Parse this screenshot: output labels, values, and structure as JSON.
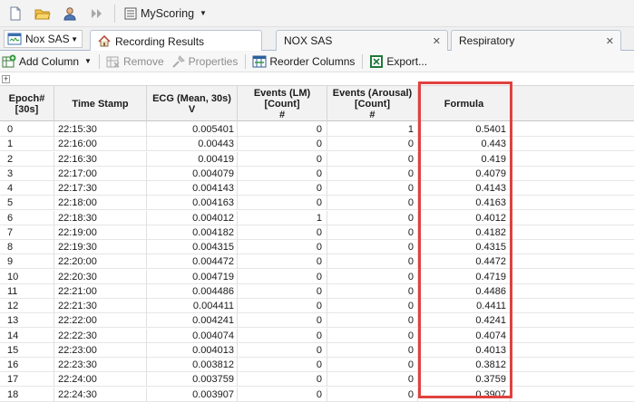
{
  "toolbar": {
    "scoring_label": "MyScoring",
    "icons": [
      "new-file-icon",
      "open-folder-icon",
      "user-icon",
      "forward-icon",
      "scoring-list-icon"
    ]
  },
  "tabbar": {
    "combo_value": "Nox SAS",
    "tabs": [
      {
        "label": "Recording Results",
        "active": true
      },
      {
        "label": "NOX SAS",
        "active": false
      },
      {
        "label": "Respiratory",
        "active": false
      }
    ]
  },
  "actions": {
    "add_column": "Add Column",
    "remove": "Remove",
    "properties": "Properties",
    "reorder_columns": "Reorder Columns",
    "export": "Export..."
  },
  "grid": {
    "headers": [
      "Epoch#\n[30s]",
      "Time Stamp",
      "ECG (Mean, 30s)\nV",
      "Events (LM)\n[Count]\n#",
      "Events (Arousal)\n[Count]\n#",
      "Formula"
    ],
    "rows": [
      [
        "0",
        "22:15:30",
        "0.005401",
        "0",
        "1",
        "0.5401"
      ],
      [
        "1",
        "22:16:00",
        "0.00443",
        "0",
        "0",
        "0.443"
      ],
      [
        "2",
        "22:16:30",
        "0.00419",
        "0",
        "0",
        "0.419"
      ],
      [
        "3",
        "22:17:00",
        "0.004079",
        "0",
        "0",
        "0.4079"
      ],
      [
        "4",
        "22:17:30",
        "0.004143",
        "0",
        "0",
        "0.4143"
      ],
      [
        "5",
        "22:18:00",
        "0.004163",
        "0",
        "0",
        "0.4163"
      ],
      [
        "6",
        "22:18:30",
        "0.004012",
        "1",
        "0",
        "0.4012"
      ],
      [
        "7",
        "22:19:00",
        "0.004182",
        "0",
        "0",
        "0.4182"
      ],
      [
        "8",
        "22:19:30",
        "0.004315",
        "0",
        "0",
        "0.4315"
      ],
      [
        "9",
        "22:20:00",
        "0.004472",
        "0",
        "0",
        "0.4472"
      ],
      [
        "10",
        "22:20:30",
        "0.004719",
        "0",
        "0",
        "0.4719"
      ],
      [
        "11",
        "22:21:00",
        "0.004486",
        "0",
        "0",
        "0.4486"
      ],
      [
        "12",
        "22:21:30",
        "0.004411",
        "0",
        "0",
        "0.4411"
      ],
      [
        "13",
        "22:22:00",
        "0.004241",
        "0",
        "0",
        "0.4241"
      ],
      [
        "14",
        "22:22:30",
        "0.004074",
        "0",
        "0",
        "0.4074"
      ],
      [
        "15",
        "22:23:00",
        "0.004013",
        "0",
        "0",
        "0.4013"
      ],
      [
        "16",
        "22:23:30",
        "0.003812",
        "0",
        "0",
        "0.3812"
      ],
      [
        "17",
        "22:24:00",
        "0.003759",
        "0",
        "0",
        "0.3759"
      ],
      [
        "18",
        "22:24:30",
        "0.003907",
        "0",
        "0",
        "0.3907"
      ]
    ]
  },
  "colors": {
    "highlight": "#e0413f"
  }
}
